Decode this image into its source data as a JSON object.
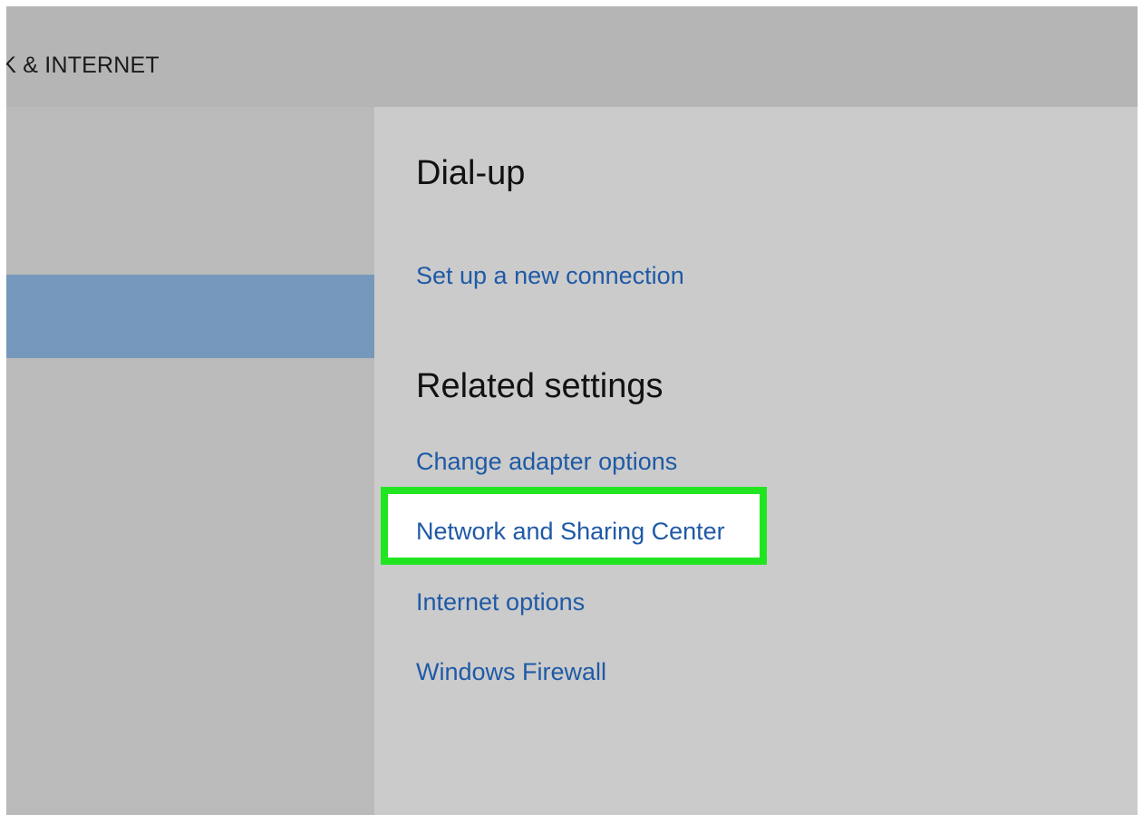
{
  "header": {
    "title": "RK & INTERNET"
  },
  "sidebar": {
    "selected_item_label": ""
  },
  "content": {
    "dialup": {
      "heading": "Dial-up",
      "link": "Set up a new connection"
    },
    "related": {
      "heading": "Related settings",
      "links": [
        "Change adapter options",
        "Network and Sharing Center",
        "Internet options",
        "Windows Firewall"
      ],
      "highlighted_index": 1
    }
  },
  "colors": {
    "link": "#1f5aa6",
    "selection": "#7598bc",
    "highlight_border": "#22e522",
    "header_bg": "#b5b5b5",
    "sidebar_bg": "#bababa",
    "content_bg": "#cbcbcb"
  }
}
